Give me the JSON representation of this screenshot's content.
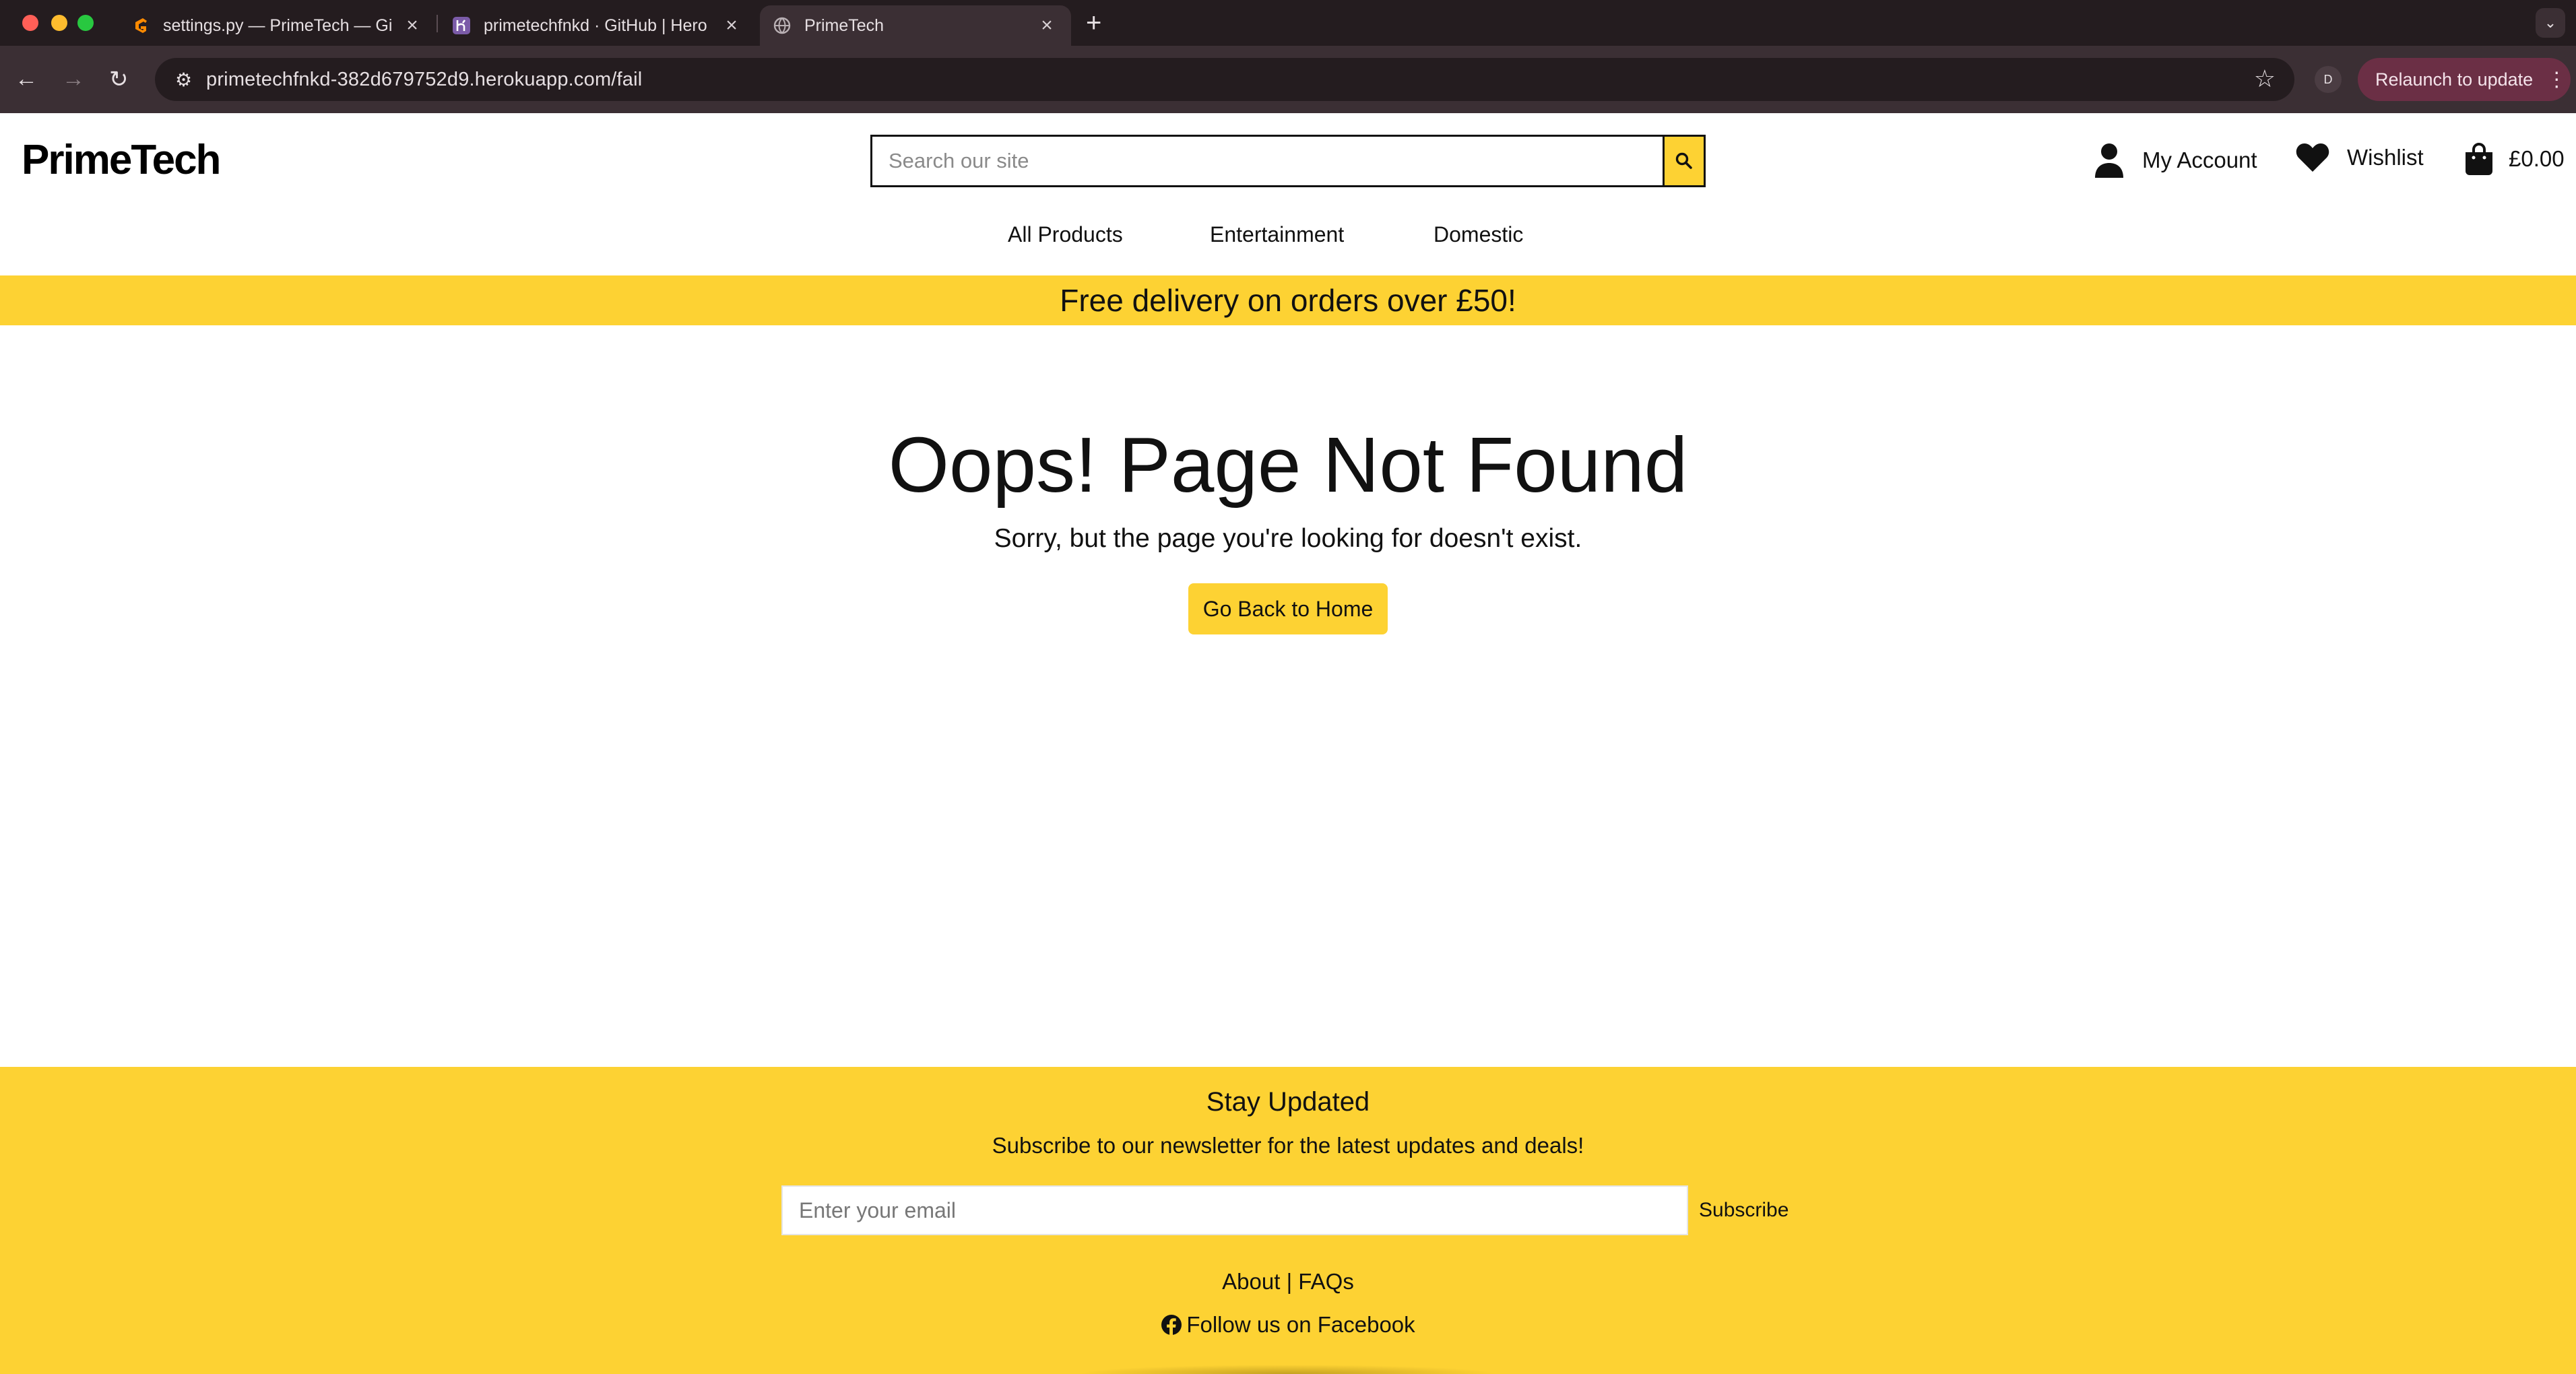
{
  "browser": {
    "tabs": [
      {
        "title": "settings.py — PrimeTech — Gi",
        "favicon": "gitpod-icon"
      },
      {
        "title": "primetechfnkd · GitHub | Hero",
        "favicon": "heroku-icon"
      },
      {
        "title": "PrimeTech",
        "favicon": "globe-icon",
        "active": true
      }
    ],
    "url": "primetechfnkd-382d679752d9.herokuapp.com/fail",
    "profile_initial": "D",
    "relaunch_label": "Relaunch to update"
  },
  "header": {
    "logo": "PrimeTech",
    "search_placeholder": "Search our site",
    "account_label": "My Account",
    "wishlist_label": "Wishlist",
    "cart_total": "£0.00"
  },
  "nav": {
    "items": [
      {
        "label": "All Products"
      },
      {
        "label": "Entertainment"
      },
      {
        "label": "Domestic"
      }
    ]
  },
  "banner": {
    "text": "Free delivery on orders over £50!"
  },
  "error": {
    "title": "Oops! Page Not Found",
    "message": "Sorry, but the page you're looking for doesn't exist.",
    "button": "Go Back to Home"
  },
  "footer": {
    "title": "Stay Updated",
    "subtitle": "Subscribe to our newsletter for the latest updates and deals!",
    "email_placeholder": "Enter your email",
    "subscribe": "Subscribe",
    "links": "About | FAQs",
    "facebook": "Follow us on Facebook"
  },
  "colors": {
    "accent": "#fdd233",
    "chrome_dark": "#241c1f",
    "chrome_toolbar": "#3b2f34",
    "relaunch": "#6b2f45"
  }
}
